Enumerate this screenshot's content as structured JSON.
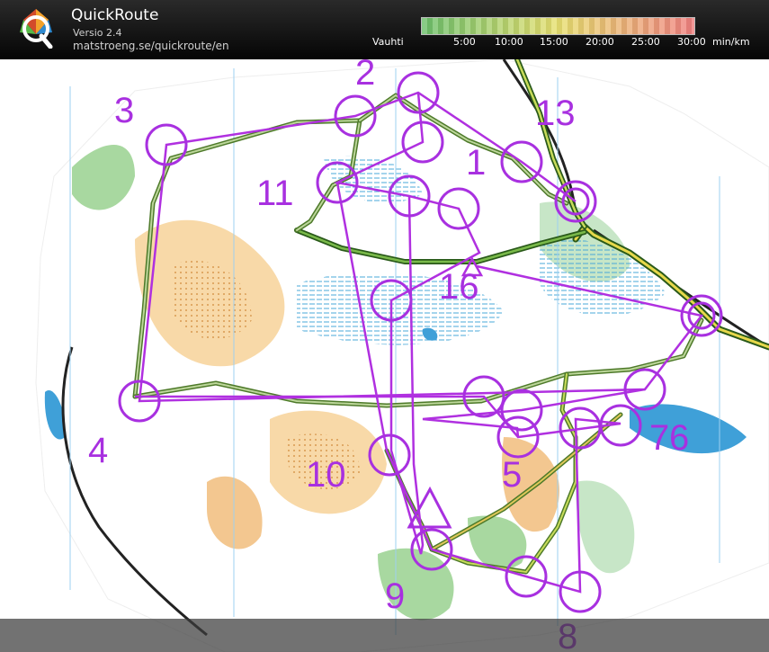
{
  "app": {
    "name": "QuickRoute",
    "version": "Versio 2.4",
    "url": "matstroeng.se/quickroute/en"
  },
  "pace_scale": {
    "label": "Vauhti",
    "ticks": [
      "5:00",
      "10:00",
      "15:00",
      "20:00",
      "25:00",
      "30:00",
      "min/km"
    ],
    "colors": {
      "fast": "#6cc06c",
      "medium": "#e8e070",
      "slow": "#f08080"
    }
  },
  "course": {
    "control_color": "#b030e0",
    "route_color": "#3a8a20",
    "controls": [
      "2",
      "3",
      "13",
      "1",
      "11",
      "16",
      "4",
      "7",
      "6",
      "10",
      "5",
      "9",
      "8"
    ]
  }
}
